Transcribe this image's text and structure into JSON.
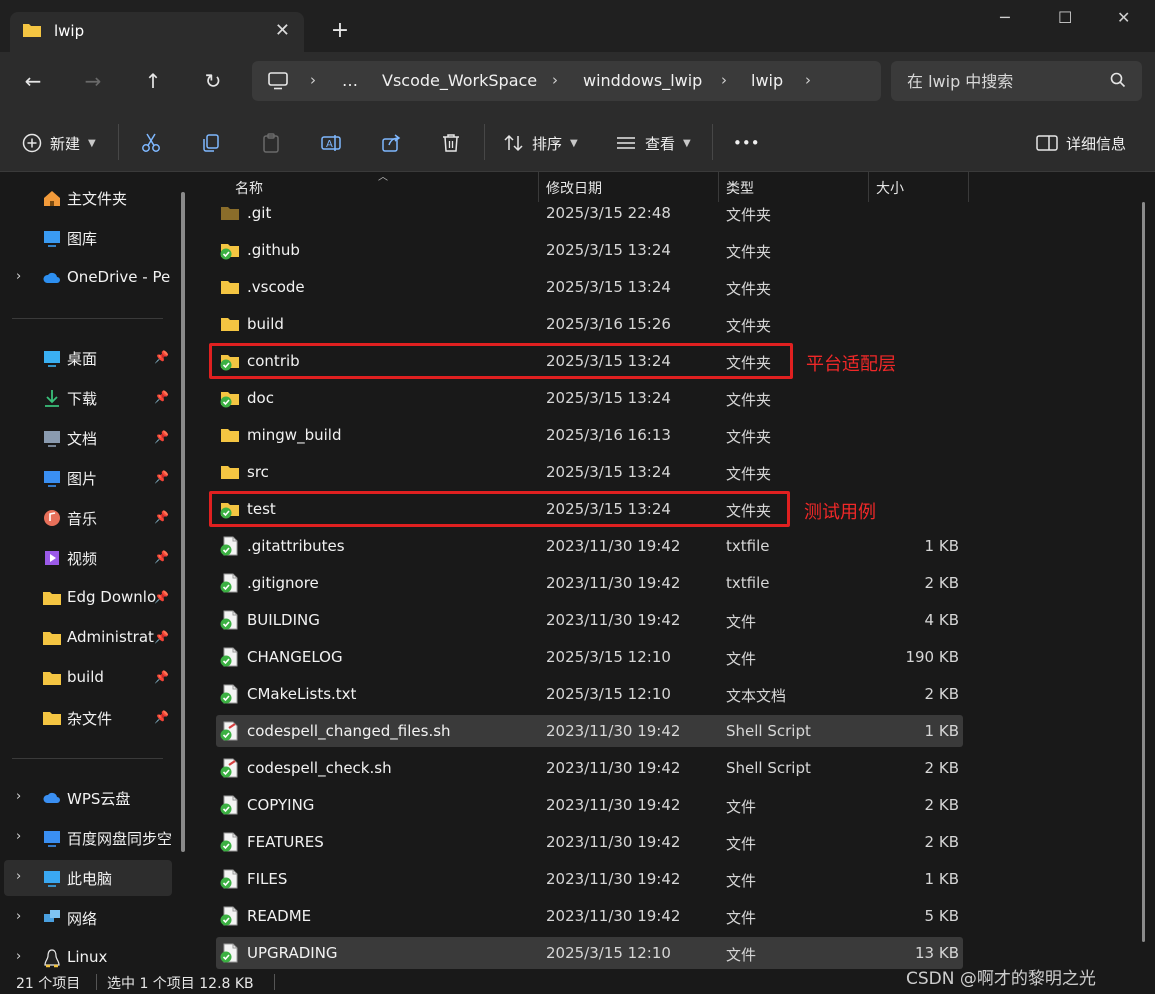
{
  "window": {
    "tab_title": "lwip",
    "tab_close": "✕",
    "new_tab": "+",
    "controls": {
      "minimize": "─",
      "maximize": "☐",
      "close": "✕"
    }
  },
  "nav": {
    "back": "←",
    "forward": "→",
    "up": "↑",
    "refresh": "↻",
    "breadcrumb": [
      "…",
      "Vscode_WorkSpace",
      "winddows_lwip",
      "lwip"
    ],
    "search_placeholder": "在 lwip 中搜索"
  },
  "toolbar": {
    "new_label": "新建",
    "sort_label": "排序",
    "view_label": "查看",
    "more_label": "•••",
    "details_label": "详细信息"
  },
  "sidebar": {
    "items": [
      {
        "label": "主文件夹",
        "icon": "home-icon",
        "expandable": false,
        "pinned": false
      },
      {
        "label": "图库",
        "icon": "gallery-icon",
        "expandable": false,
        "pinned": false
      },
      {
        "label": "OneDrive - Per",
        "icon": "onedrive-icon",
        "expandable": true,
        "pinned": false
      },
      {
        "label": "桌面",
        "icon": "desktop-icon",
        "expandable": false,
        "pinned": true
      },
      {
        "label": "下载",
        "icon": "download-icon",
        "expandable": false,
        "pinned": true
      },
      {
        "label": "文档",
        "icon": "documents-icon",
        "expandable": false,
        "pinned": true
      },
      {
        "label": "图片",
        "icon": "pictures-icon",
        "expandable": false,
        "pinned": true
      },
      {
        "label": "音乐",
        "icon": "music-icon",
        "expandable": false,
        "pinned": true
      },
      {
        "label": "视频",
        "icon": "videos-icon",
        "expandable": false,
        "pinned": true
      },
      {
        "label": "Edg Downlo",
        "icon": "folder-icon",
        "expandable": false,
        "pinned": true
      },
      {
        "label": "Administrat",
        "icon": "folder-icon",
        "expandable": false,
        "pinned": true
      },
      {
        "label": "build",
        "icon": "folder-icon",
        "expandable": false,
        "pinned": true
      },
      {
        "label": "杂文件",
        "icon": "folder-icon",
        "expandable": false,
        "pinned": true
      },
      {
        "label": "WPS云盘",
        "icon": "wps-cloud-icon",
        "expandable": true,
        "pinned": false
      },
      {
        "label": "百度网盘同步空",
        "icon": "baidu-netdisk-icon",
        "expandable": true,
        "pinned": false
      },
      {
        "label": "此电脑",
        "icon": "this-pc-icon",
        "expandable": true,
        "pinned": false,
        "selected": true
      },
      {
        "label": "网络",
        "icon": "network-icon",
        "expandable": true,
        "pinned": false
      },
      {
        "label": "Linux",
        "icon": "linux-icon",
        "expandable": true,
        "pinned": false
      }
    ],
    "pin_glyph": "📌",
    "chevron_glyph": "›"
  },
  "files": {
    "columns": [
      "名称",
      "修改日期",
      "类型",
      "大小"
    ],
    "rows": [
      {
        "name": ".git",
        "date": "2025/3/15 22:48",
        "type": "文件夹",
        "size": "",
        "kind": "folder-dim"
      },
      {
        "name": ".github",
        "date": "2025/3/15 13:24",
        "type": "文件夹",
        "size": "",
        "kind": "folder-git"
      },
      {
        "name": ".vscode",
        "date": "2025/3/15 13:24",
        "type": "文件夹",
        "size": "",
        "kind": "folder"
      },
      {
        "name": "build",
        "date": "2025/3/16 15:26",
        "type": "文件夹",
        "size": "",
        "kind": "folder"
      },
      {
        "name": "contrib",
        "date": "2025/3/15 13:24",
        "type": "文件夹",
        "size": "",
        "kind": "folder-git"
      },
      {
        "name": "doc",
        "date": "2025/3/15 13:24",
        "type": "文件夹",
        "size": "",
        "kind": "folder-git"
      },
      {
        "name": "mingw_build",
        "date": "2025/3/16 16:13",
        "type": "文件夹",
        "size": "",
        "kind": "folder"
      },
      {
        "name": "src",
        "date": "2025/3/15 13:24",
        "type": "文件夹",
        "size": "",
        "kind": "folder"
      },
      {
        "name": "test",
        "date": "2025/3/15 13:24",
        "type": "文件夹",
        "size": "",
        "kind": "folder-git"
      },
      {
        "name": ".gitattributes",
        "date": "2023/11/30 19:42",
        "type": "txtfile",
        "size": "1 KB",
        "kind": "file-git"
      },
      {
        "name": ".gitignore",
        "date": "2023/11/30 19:42",
        "type": "txtfile",
        "size": "2 KB",
        "kind": "file-git"
      },
      {
        "name": "BUILDING",
        "date": "2023/11/30 19:42",
        "type": "文件",
        "size": "4 KB",
        "kind": "file-git"
      },
      {
        "name": "CHANGELOG",
        "date": "2025/3/15 12:10",
        "type": "文件",
        "size": "190 KB",
        "kind": "file-git"
      },
      {
        "name": "CMakeLists.txt",
        "date": "2025/3/15 12:10",
        "type": "文本文档",
        "size": "2 KB",
        "kind": "file-git"
      },
      {
        "name": "codespell_changed_files.sh",
        "date": "2023/11/30 19:42",
        "type": "Shell Script",
        "size": "1 KB",
        "kind": "script-git",
        "highlight": true
      },
      {
        "name": "codespell_check.sh",
        "date": "2023/11/30 19:42",
        "type": "Shell Script",
        "size": "2 KB",
        "kind": "script-git"
      },
      {
        "name": "COPYING",
        "date": "2023/11/30 19:42",
        "type": "文件",
        "size": "2 KB",
        "kind": "file-git"
      },
      {
        "name": "FEATURES",
        "date": "2023/11/30 19:42",
        "type": "文件",
        "size": "2 KB",
        "kind": "file-git"
      },
      {
        "name": "FILES",
        "date": "2023/11/30 19:42",
        "type": "文件",
        "size": "1 KB",
        "kind": "file-git"
      },
      {
        "name": "README",
        "date": "2023/11/30 19:42",
        "type": "文件",
        "size": "5 KB",
        "kind": "file-git"
      },
      {
        "name": "UPGRADING",
        "date": "2025/3/15 12:10",
        "type": "文件",
        "size": "13 KB",
        "kind": "file-git",
        "selected": true
      }
    ]
  },
  "annotations": [
    {
      "row": "contrib",
      "text": "平台适配层"
    },
    {
      "row": "test",
      "text": "测试用例"
    }
  ],
  "status": {
    "item_count": "21 个项目",
    "selection": "选中 1 个项目  12.8 KB",
    "watermark": "CSDN @啊才的黎明之光"
  },
  "colors": {
    "folder": "#f4c542",
    "git_badge": "#3cb043",
    "annotation": "#e02020"
  }
}
